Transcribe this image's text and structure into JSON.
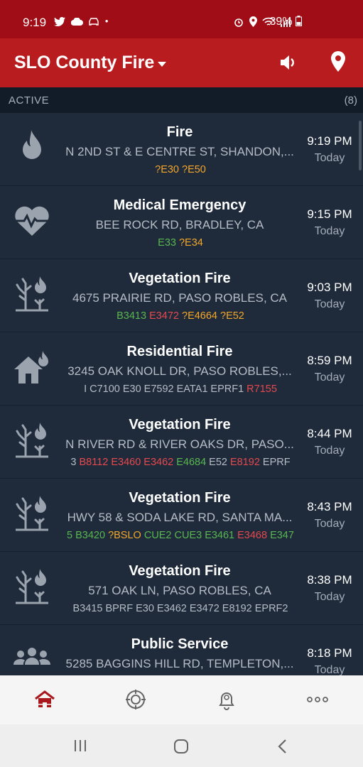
{
  "status_bar": {
    "time": "9:19",
    "battery": "39%"
  },
  "app_bar": {
    "title": "SLO County Fire"
  },
  "section": {
    "label": "ACTIVE",
    "count": "(8)"
  },
  "incidents": [
    {
      "type": "Fire",
      "address": "N 2ND ST & E CENTRE ST, SHANDON,...",
      "time": "9:19 PM",
      "day": "Today",
      "icon": "fire-icon",
      "units": [
        {
          "t": "?E30",
          "c": "orange"
        },
        {
          "t": "?E50",
          "c": "orange"
        }
      ]
    },
    {
      "type": "Medical Emergency",
      "address": "BEE ROCK RD, BRADLEY, CA",
      "time": "9:15 PM",
      "day": "Today",
      "icon": "heartbeat-icon",
      "units": [
        {
          "t": "E33",
          "c": "green"
        },
        {
          "t": "?E34",
          "c": "orange"
        }
      ]
    },
    {
      "type": "Vegetation Fire",
      "address": "4675 PRAIRIE RD, PASO ROBLES, CA",
      "time": "9:03 PM",
      "day": "Today",
      "icon": "vegetation-fire-icon",
      "units": [
        {
          "t": "B3413",
          "c": "green"
        },
        {
          "t": "E3472",
          "c": "red"
        },
        {
          "t": "?E4664",
          "c": "orange"
        },
        {
          "t": "?E52",
          "c": "orange"
        }
      ]
    },
    {
      "type": "Residential Fire",
      "address": "3245 OAK KNOLL DR, PASO ROBLES,...",
      "time": "8:59 PM",
      "day": "Today",
      "icon": "house-fire-icon",
      "units": [
        {
          "t": "I",
          "c": "gray"
        },
        {
          "t": "C7100",
          "c": "gray"
        },
        {
          "t": "E30",
          "c": "gray"
        },
        {
          "t": "E7592",
          "c": "gray"
        },
        {
          "t": "EATA1",
          "c": "gray"
        },
        {
          "t": "EPRF1",
          "c": "gray"
        },
        {
          "t": "R7155",
          "c": "red"
        }
      ]
    },
    {
      "type": "Vegetation Fire",
      "address": "N RIVER RD & RIVER OAKS DR, PASO...",
      "time": "8:44 PM",
      "day": "Today",
      "icon": "vegetation-fire-icon",
      "units": [
        {
          "t": "3",
          "c": "gray"
        },
        {
          "t": "B8112",
          "c": "red"
        },
        {
          "t": "E3460",
          "c": "red"
        },
        {
          "t": "E3462",
          "c": "red"
        },
        {
          "t": "E4684",
          "c": "green"
        },
        {
          "t": "E52",
          "c": "gray"
        },
        {
          "t": "E8192",
          "c": "red"
        },
        {
          "t": "EPRF",
          "c": "gray"
        }
      ]
    },
    {
      "type": "Vegetation Fire",
      "address": "HWY 58 & SODA LAKE RD, SANTA MA...",
      "time": "8:43 PM",
      "day": "Today",
      "icon": "vegetation-fire-icon",
      "units": [
        {
          "t": "5",
          "c": "green"
        },
        {
          "t": "B3420",
          "c": "green"
        },
        {
          "t": "?BSLO",
          "c": "orange"
        },
        {
          "t": "CUE2",
          "c": "green"
        },
        {
          "t": "CUE3",
          "c": "green"
        },
        {
          "t": "E3461",
          "c": "green"
        },
        {
          "t": "E3468",
          "c": "red"
        },
        {
          "t": "E347",
          "c": "green"
        }
      ]
    },
    {
      "type": "Vegetation Fire",
      "address": "571 OAK LN, PASO ROBLES, CA",
      "time": "8:38 PM",
      "day": "Today",
      "icon": "vegetation-fire-icon",
      "units": [
        {
          "t": "B3415",
          "c": "gray"
        },
        {
          "t": "BPRF",
          "c": "gray"
        },
        {
          "t": "E30",
          "c": "gray"
        },
        {
          "t": "E3462",
          "c": "gray"
        },
        {
          "t": "E3472",
          "c": "gray"
        },
        {
          "t": "E8192",
          "c": "gray"
        },
        {
          "t": "EPRF2",
          "c": "gray"
        }
      ]
    },
    {
      "type": "Public Service",
      "address": "5285 BAGGINS HILL RD, TEMPLETON,...",
      "time": "8:18 PM",
      "day": "Today",
      "icon": "people-group-icon",
      "units": []
    }
  ],
  "colors": {
    "status_bar": "#a00d17",
    "app_bar": "#b81c1f",
    "row_bg": "#1f2b3b",
    "orange": "#f4a62a",
    "green": "#58b74f",
    "red": "#e5484d",
    "nav_active": "#a8181c"
  },
  "bottom_nav": {
    "items": [
      "incidents-home-icon",
      "fire-department-icon",
      "alerts-bell-icon",
      "more-icon"
    ]
  }
}
